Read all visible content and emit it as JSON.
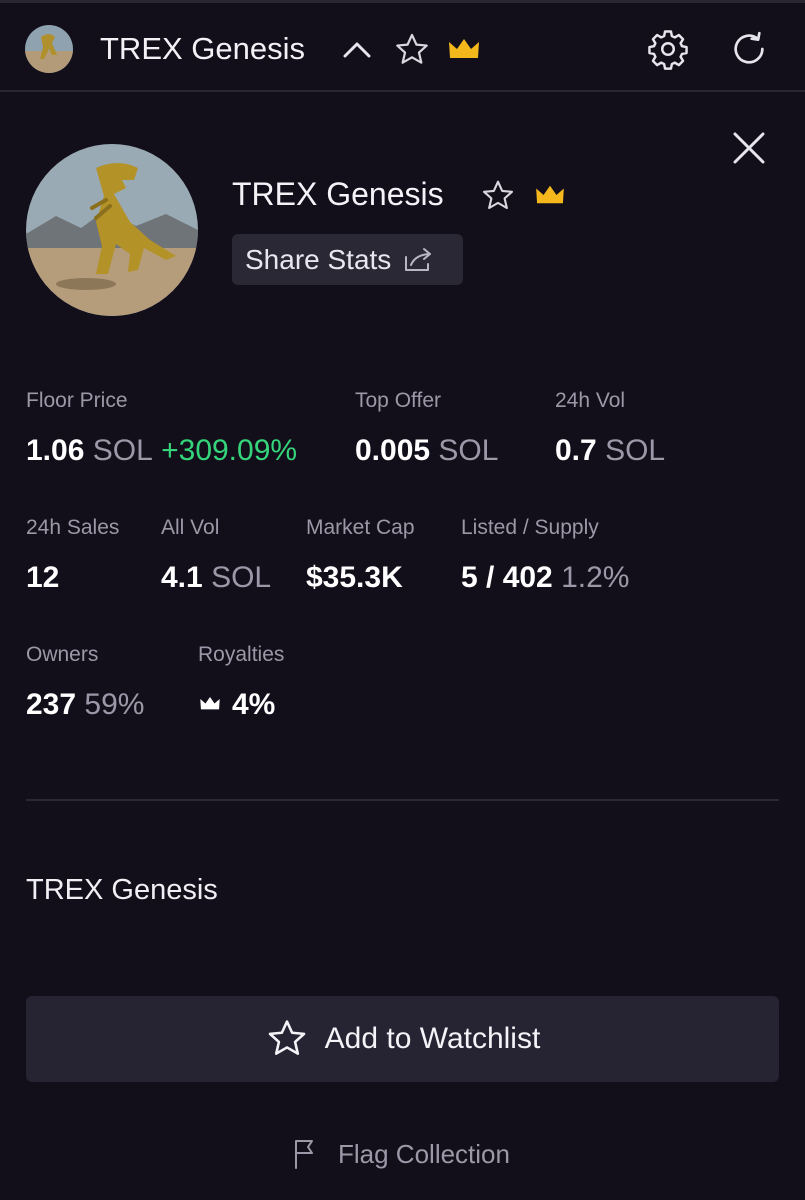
{
  "colors": {
    "background": "#120f1a",
    "accent_gold": "#f4b81c",
    "positive": "#35d37a",
    "muted_text": "#9c98a8",
    "button_bg": "#262332"
  },
  "header": {
    "title": "TREX Genesis",
    "icons": [
      "chevron-up-icon",
      "star-outline-icon",
      "crown-icon",
      "gear-icon",
      "refresh-icon"
    ]
  },
  "card": {
    "title": "TREX Genesis",
    "share_label": "Share Stats",
    "icons": [
      "close-icon",
      "star-outline-icon",
      "crown-icon",
      "share-icon"
    ]
  },
  "stats": {
    "floor_price": {
      "label": "Floor Price",
      "value": "1.06",
      "unit": "SOL",
      "change": "+309.09%"
    },
    "top_offer": {
      "label": "Top Offer",
      "value": "0.005",
      "unit": "SOL"
    },
    "vol_24h": {
      "label": "24h Vol",
      "value": "0.7",
      "unit": "SOL"
    },
    "sales_24h": {
      "label": "24h Sales",
      "value": "12"
    },
    "all_vol": {
      "label": "All Vol",
      "value": "4.1",
      "unit": "SOL"
    },
    "market_cap": {
      "label": "Market Cap",
      "value": "$35.3K"
    },
    "listed_supply": {
      "label": "Listed / Supply",
      "value": "5 / 402",
      "pct": "1.2%"
    },
    "owners": {
      "label": "Owners",
      "value": "237",
      "pct": "59%"
    },
    "royalties": {
      "label": "Royalties",
      "value": "4%"
    }
  },
  "description": "TREX Genesis",
  "watchlist_label": "Add to Watchlist",
  "flag_label": "Flag Collection"
}
